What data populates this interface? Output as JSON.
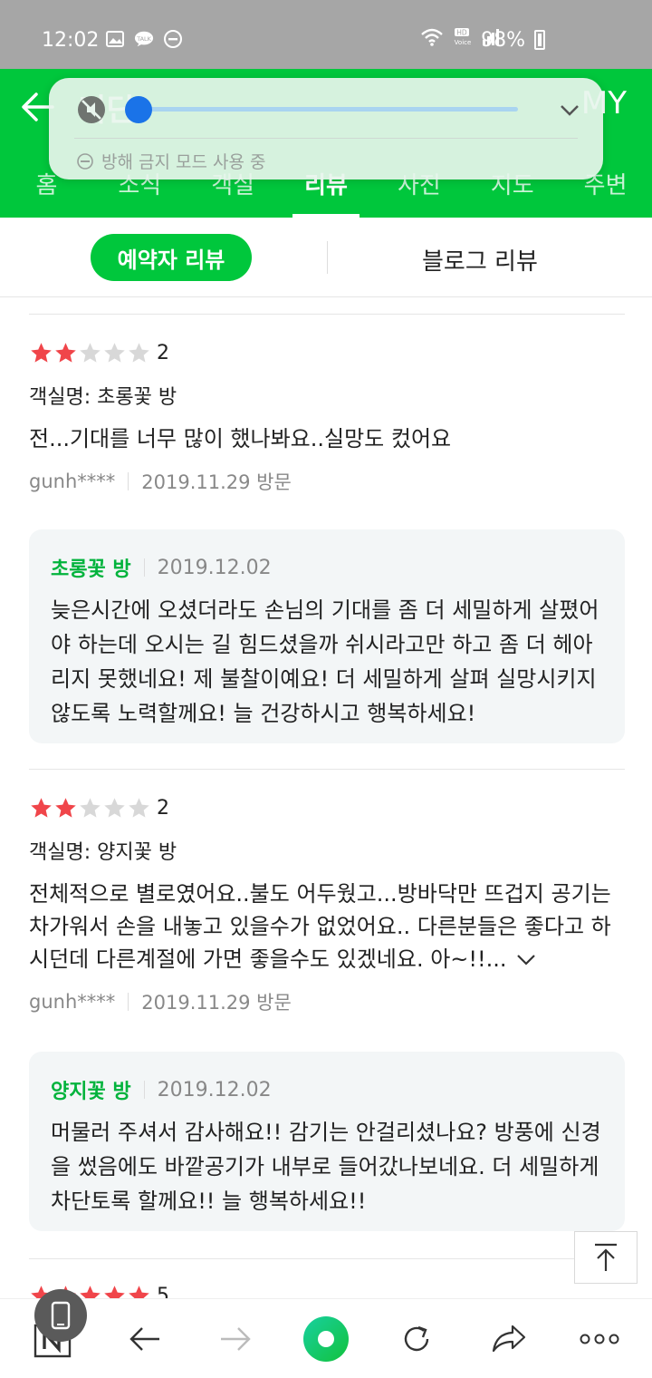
{
  "status_bar": {
    "time": "12:02",
    "battery": "98%",
    "icons": [
      "image-icon",
      "talk-icon",
      "dnd-icon",
      "wifi-icon",
      "hd-voice-icon",
      "signal-icon",
      "battery-icon"
    ]
  },
  "header": {
    "title": "디딘",
    "my_label": "MY"
  },
  "overlay": {
    "dnd_text": "방해 금지 모드 사용 중",
    "volume_level": 0.0
  },
  "tabs": [
    {
      "label": "홈"
    },
    {
      "label": "소식"
    },
    {
      "label": "객실"
    },
    {
      "label": "리뷰"
    },
    {
      "label": "사진"
    },
    {
      "label": "지도"
    },
    {
      "label": "주변"
    }
  ],
  "active_tab": "리뷰",
  "subtabs": {
    "booker_reviews": "예약자 리뷰",
    "blog_reviews": "블로그 리뷰"
  },
  "reviews": [
    {
      "rating": 2,
      "rating_label": "2",
      "room": "객실명: 초롱꽃 방",
      "text": "전...기대를 너무 많이 했나봐요..실망도 컸어요",
      "user": "gunh****",
      "visit": "2019.11.29 방문",
      "reply": {
        "room": "초롱꽃 방",
        "date": "2019.12.02",
        "text": "늦은시간에 오셨더라도 손님의 기대를 좀 더 세밀하게 살폈어야 하는데 오시는 길 힘드셨을까 쉬시라고만 하고 좀 더 헤아리지 못했네요! 제 불찰이예요! 더 세밀하게 살펴 실망시키지 않도록 노력할께요! 늘 건강하시고 행복하세요!"
      }
    },
    {
      "rating": 2,
      "rating_label": "2",
      "room": "객실명: 양지꽃 방",
      "text": "전체적으로 별로였어요..불도 어두웠고...방바닥만 뜨겁지 공기는 차가워서 손을 내놓고 있을수가 없었어요.. 다른분들은 좋다고 하시던데 다른계절에 가면 좋을수도 있겠네요. 아~!!...",
      "user": "gunh****",
      "visit": "2019.11.29 방문",
      "reply": {
        "room": "양지꽃 방",
        "date": "2019.12.02",
        "text": "머물러 주셔서 감사해요!! 감기는 안걸리셨나요? 방풍에 신경을 썼음에도 바깥공기가 내부로 들어갔나보네요. 더 세밀하게 차단토록 할께요!! 늘 행복하세요!!"
      }
    },
    {
      "rating": 5,
      "rating_label": "5"
    }
  ],
  "colors": {
    "brand_green": "#00c73c",
    "star_red": "#f0454a",
    "star_grey": "#d8d8d8"
  }
}
